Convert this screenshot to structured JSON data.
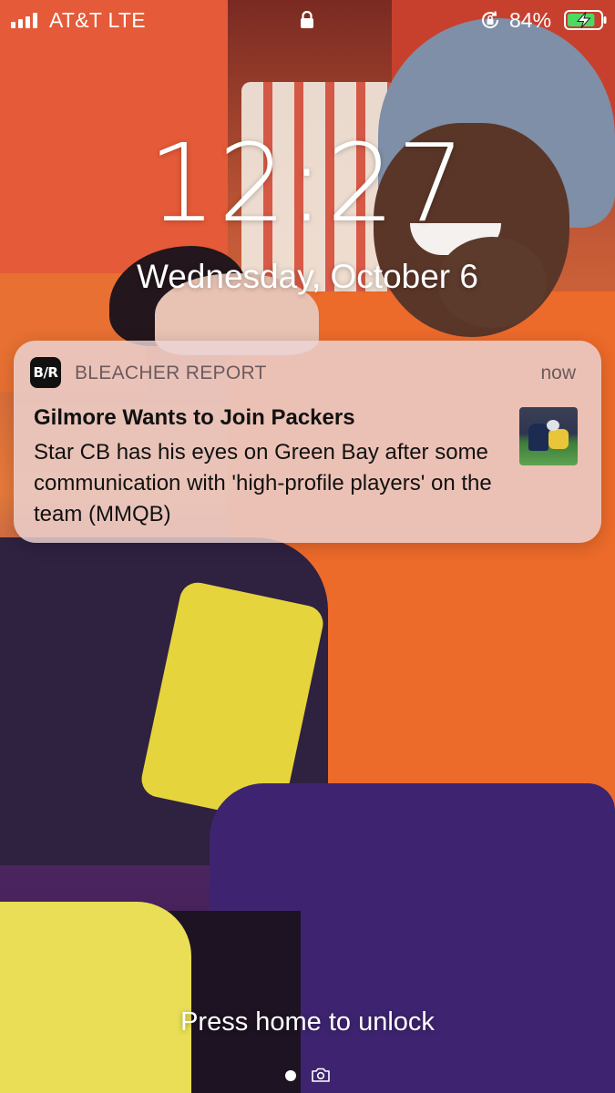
{
  "status_bar": {
    "carrier": "AT&T  LTE",
    "battery_percent": "84%",
    "signal_bars": 4,
    "battery_level": 0.84,
    "battery_charging": true,
    "icons": [
      "signal-icon",
      "lock-icon",
      "rotation-lock-icon",
      "battery-charging-icon"
    ]
  },
  "lock_screen": {
    "time": "12:27",
    "date": "Wednesday, October 6",
    "unlock_hint": "Press home to unlock"
  },
  "notification": {
    "app_icon_text": "B/R",
    "app_name": "BLEACHER REPORT",
    "time": "now",
    "title": "Gilmore Wants to Join Packers",
    "body": "Star CB has his eyes on Green Bay after some communication with 'high-profile players' on the team (MMQB)"
  },
  "page_indicator": {
    "current_page": 1,
    "icons": [
      "page-dot",
      "camera-icon"
    ]
  },
  "colors": {
    "notification_bg": "#ecd4d4",
    "notification_meta_text": "#6b5b5e",
    "battery_charging_green": "#4cd964"
  }
}
